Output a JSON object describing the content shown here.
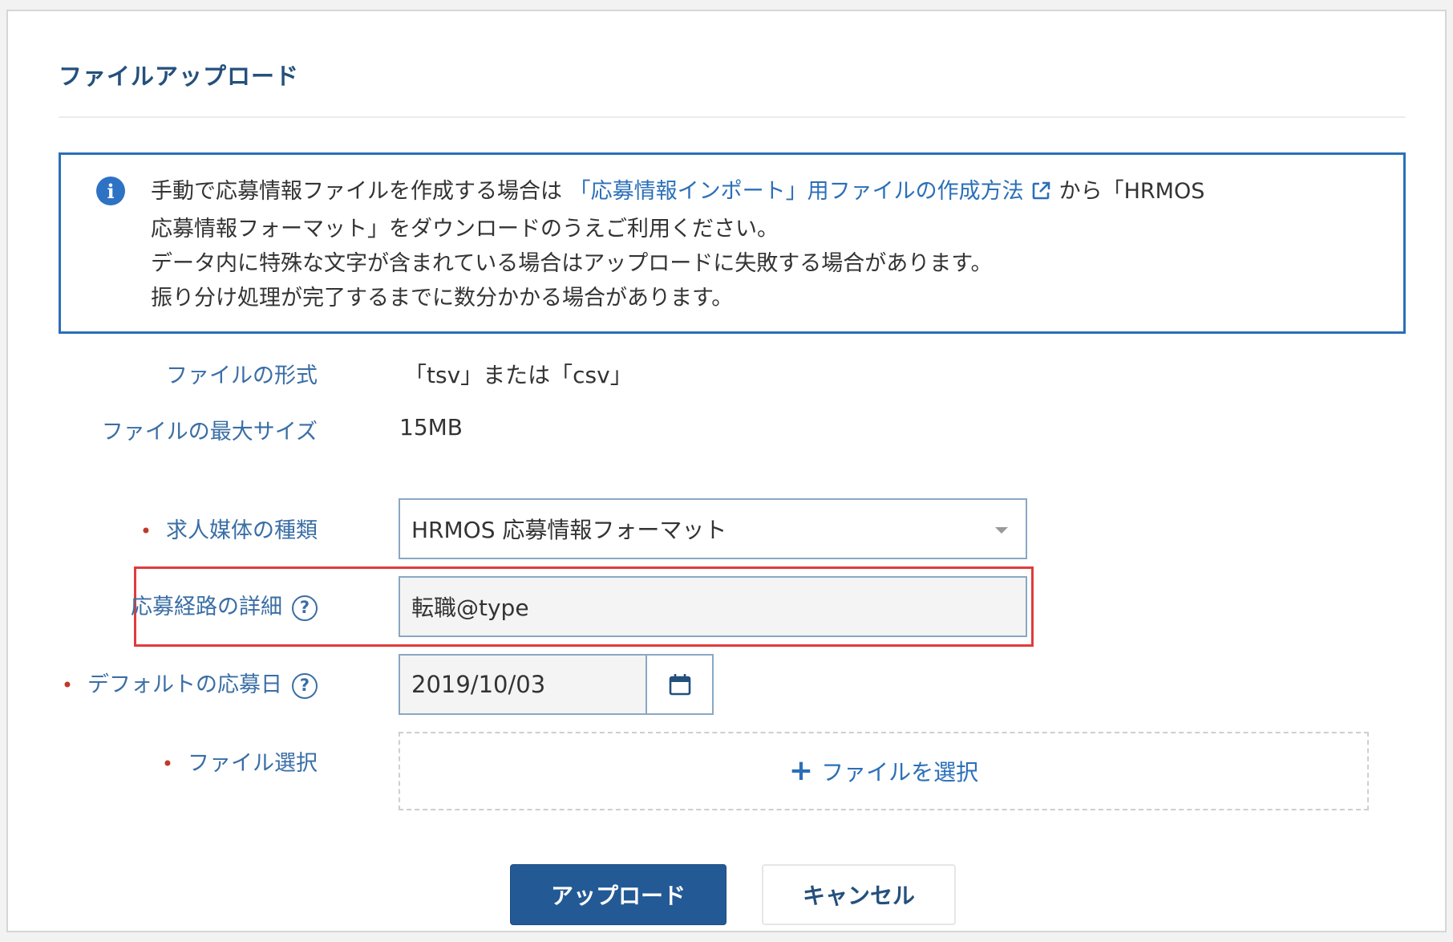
{
  "dialog": {
    "title": "ファイルアップロード"
  },
  "notice": {
    "line1_prefix": "手動で応募情報ファイルを作成する場合は",
    "link_text": "「応募情報インポート」用ファイルの作成方法",
    "line1_suffix": "から「HRMOS",
    "line2": "応募情報フォーマット」をダウンロードのうえご利用ください。",
    "line3": "データ内に特殊な文字が含まれている場合はアップロードに失敗する場合があります。",
    "line4": "振り分け処理が完了するまでに数分かかる場合があります。",
    "icon": "info-icon",
    "accent_color": "#2b6fb8"
  },
  "info": {
    "format_label": "ファイルの形式",
    "format_value": "「tsv」または「csv」",
    "max_size_label": "ファイルの最大サイズ",
    "max_size_value": "15MB"
  },
  "form": {
    "required_mark": "•",
    "help_mark": "?",
    "media_type": {
      "label": "求人媒体の種類",
      "value": "HRMOS 応募情報フォーマット"
    },
    "route_detail": {
      "label": "応募経路の詳細",
      "value": "転職@type"
    },
    "default_date": {
      "label": "デフォルトの応募日",
      "value": "2019/10/03"
    },
    "file_select": {
      "label": "ファイル選択",
      "button_label": "ファイルを選択",
      "plus": "+"
    }
  },
  "actions": {
    "upload_label": "アップロード",
    "cancel_label": "キャンセル",
    "primary_color": "#235a95",
    "highlight_color": "#e03c3c"
  }
}
